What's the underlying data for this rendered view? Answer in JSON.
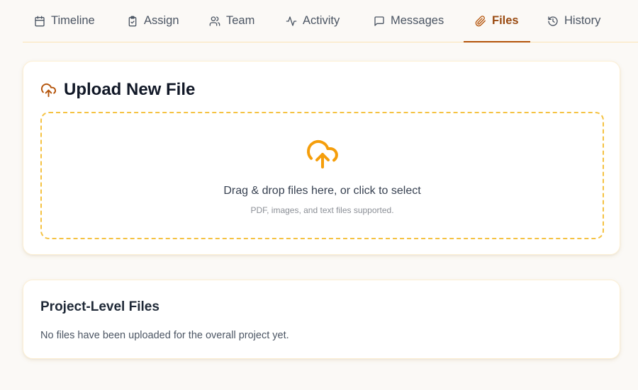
{
  "tabs": [
    {
      "label": "Timeline",
      "icon": "calendar-icon"
    },
    {
      "label": "Assign",
      "icon": "clipboard-check-icon"
    },
    {
      "label": "Team",
      "icon": "users-icon"
    },
    {
      "label": "Activity",
      "icon": "activity-icon"
    },
    {
      "label": "Messages",
      "icon": "message-square-icon"
    },
    {
      "label": "Files",
      "icon": "paperclip-icon",
      "active": true
    },
    {
      "label": "History",
      "icon": "history-icon"
    }
  ],
  "upload": {
    "title": "Upload New File",
    "icon": "cloud-upload-icon",
    "dropzone_text": "Drag & drop files here, or click to select",
    "dropzone_hint": "PDF, images, and text files supported."
  },
  "project_files": {
    "title": "Project-Level Files",
    "empty_message": "No files have been uploaded for the overall project yet."
  },
  "colors": {
    "accent": "#b45309",
    "accent_text": "#9a4b12",
    "dropzone_border": "#f5c242",
    "upload_icon": "#f59e0b",
    "tab_border": "#fbe3b4"
  }
}
